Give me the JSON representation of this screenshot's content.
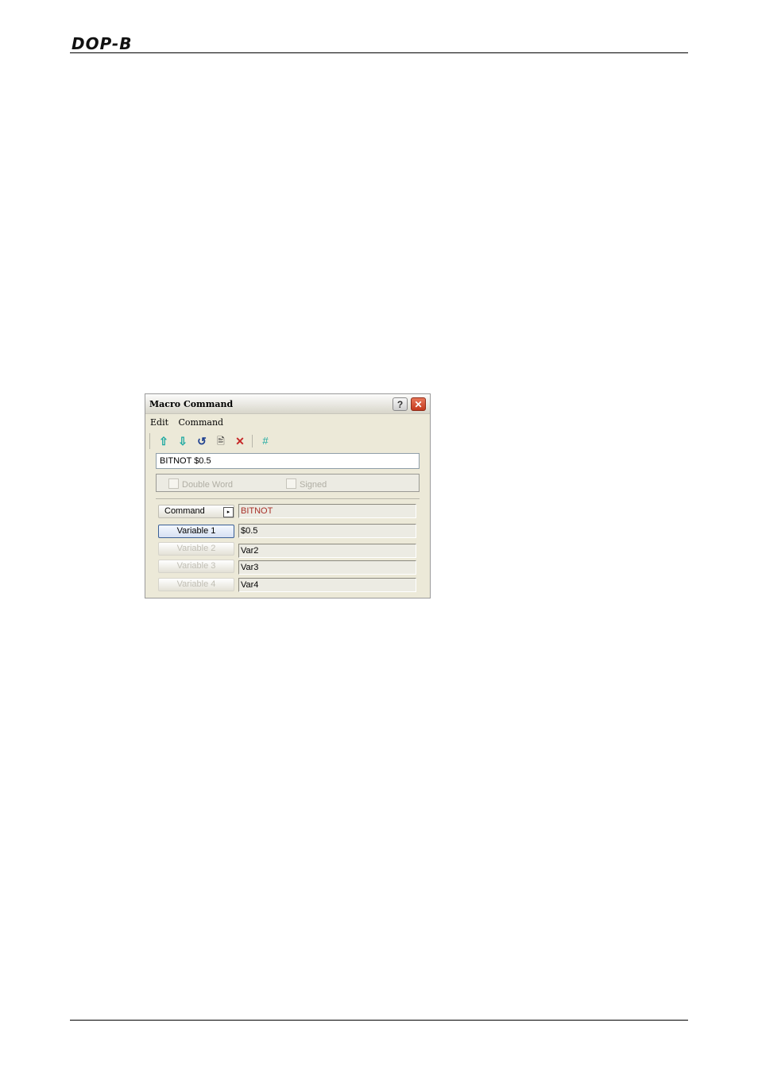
{
  "page": {
    "brand": "DOP-B"
  },
  "dialog": {
    "title": "Macro Command",
    "help_button": "?",
    "close_button": "✕",
    "menu": [
      "Edit",
      "Command"
    ],
    "toolbar": {
      "icons": [
        "move-up-icon",
        "move-down-icon",
        "refresh-icon",
        "save-icon",
        "delete-icon",
        "hash-icon"
      ],
      "glyphs": [
        "⇧",
        "⇩",
        "↺",
        "🖹",
        "✕",
        "#"
      ],
      "colors": {
        "arrows": "#1aa8a0",
        "refresh": "#1d3f8f",
        "delete": "#c62828",
        "hash": "#1aa8a0"
      }
    },
    "expression": "BITNOT $0.5",
    "options": {
      "double_word": "Double Word",
      "signed": "Signed"
    },
    "command_button": "Command",
    "command_arrow": "▸",
    "command_value": "BITNOT",
    "variables": [
      {
        "label": "Variable 1",
        "value": "$0.5",
        "enabled": true
      },
      {
        "label": "Variable 2",
        "value": "Var2",
        "enabled": false
      },
      {
        "label": "Variable 3",
        "value": "Var3",
        "enabled": false
      },
      {
        "label": "Variable 4",
        "value": "Var4",
        "enabled": false
      }
    ]
  }
}
